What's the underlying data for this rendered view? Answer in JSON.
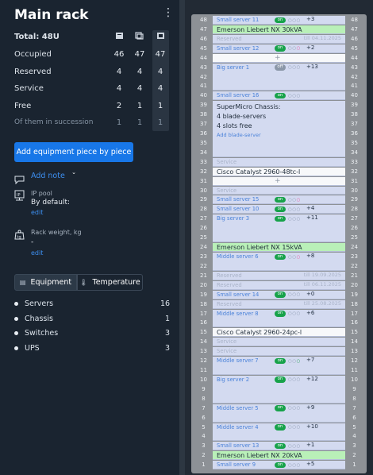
{
  "header": {
    "title": "Main rack",
    "chevron": "⌄",
    "menu": "⋮"
  },
  "summary": {
    "total_label": "Total: 48U",
    "rows": [
      {
        "label": "Occupied",
        "values": [
          "46",
          "47",
          "47"
        ]
      },
      {
        "label": "Reserved",
        "values": [
          "4",
          "4",
          "4"
        ]
      },
      {
        "label": "Service",
        "values": [
          "4",
          "4",
          "4"
        ]
      },
      {
        "label": "Free",
        "values": [
          "2",
          "1",
          "1"
        ]
      },
      {
        "label": "Of them in succession",
        "values": [
          "1",
          "1",
          "1"
        ]
      }
    ]
  },
  "add_button": {
    "label": "Add equipment piece by piece",
    "caret": "⌄"
  },
  "add_note": {
    "label": "Add note"
  },
  "ip_pool": {
    "label": "IP pool",
    "value": "By default:",
    "edit": "edit"
  },
  "rack_weight": {
    "label": "Rack weight, kg",
    "value": "-",
    "edit": "edit"
  },
  "tabs": [
    {
      "label": "Equipment",
      "active": true
    },
    {
      "label": "Temperature",
      "active": false
    }
  ],
  "legend": [
    {
      "label": "Servers",
      "count": "16"
    },
    {
      "label": "Chassis",
      "count": "1"
    },
    {
      "label": "Switches",
      "count": "3"
    },
    {
      "label": "UPS",
      "count": "3"
    }
  ],
  "rack": {
    "units": [
      {
        "u": 48,
        "kind": "srv",
        "text": "Small server 11",
        "status": "on",
        "plus": "+3"
      },
      {
        "u": 47,
        "kind": "ups",
        "text": "Emerson Liebert NX 30kVA"
      },
      {
        "u": 46,
        "kind": "res",
        "text": "Reserved",
        "date": "till 04.11.2025"
      },
      {
        "u": 45,
        "kind": "srv",
        "text": "Small server 12",
        "status": "on",
        "plus": "+2",
        "pink": true
      },
      {
        "u": 44,
        "kind": "free",
        "text": "+"
      },
      {
        "u": 43,
        "kind": "srv",
        "text": "Big server 1",
        "status": "off",
        "plus": "+13",
        "span": 3
      },
      {
        "u": 40,
        "kind": "srv",
        "text": "Small server 16",
        "status": "on",
        "plus": ""
      },
      {
        "u": 39,
        "kind": "chassis",
        "span": 6,
        "lines": [
          "SuperMicro Chassis:",
          "4 blade-servers",
          "4 slots free"
        ],
        "link": "Add blade-server"
      },
      {
        "u": 33,
        "kind": "svc",
        "text": "Service"
      },
      {
        "u": 32,
        "kind": "sw",
        "text": "Cisco Catalyst 2960-48tc-l"
      },
      {
        "u": 31,
        "kind": "free",
        "text": "+"
      },
      {
        "u": 30,
        "kind": "svc",
        "text": "Service"
      },
      {
        "u": 29,
        "kind": "srv",
        "text": "Small server 15",
        "status": "on",
        "plus": "",
        "pink": true
      },
      {
        "u": 28,
        "kind": "srv",
        "text": "Small server 10",
        "status": "on",
        "plus": "+4"
      },
      {
        "u": 27,
        "kind": "srv",
        "text": "Big server 3",
        "status": "on",
        "plus": "+11",
        "span": 3
      },
      {
        "u": 24,
        "kind": "ups",
        "text": "Emerson Liebert NX 15kVA"
      },
      {
        "u": 23,
        "kind": "srv",
        "text": "Middle server 6",
        "status": "on",
        "plus": "+8",
        "pink": true,
        "span": 2
      },
      {
        "u": 21,
        "kind": "res",
        "text": "Reserved",
        "date": "till 19.09.2025"
      },
      {
        "u": 20,
        "kind": "res",
        "text": "Reserved",
        "date": "till 06.11.2025"
      },
      {
        "u": 19,
        "kind": "srv",
        "text": "Small server 14",
        "status": "on",
        "plus": "+0"
      },
      {
        "u": 18,
        "kind": "res",
        "text": "Reserved",
        "date": "till 25.08.2025"
      },
      {
        "u": 17,
        "kind": "srv",
        "text": "Middle server 8",
        "status": "on",
        "plus": "+6",
        "span": 2
      },
      {
        "u": 15,
        "kind": "sw",
        "text": "Cisco Catalyst 2960-24pc-l"
      },
      {
        "u": 14,
        "kind": "svc",
        "text": "Service"
      },
      {
        "u": 13,
        "kind": "svc",
        "text": "Service"
      },
      {
        "u": 12,
        "kind": "srv",
        "text": "Middle server 7",
        "status": "on",
        "plus": "+7",
        "green": true,
        "span": 2
      },
      {
        "u": 10,
        "kind": "srv",
        "text": "Big server 2",
        "status": "on",
        "plus": "+12",
        "span": 3
      },
      {
        "u": 7,
        "kind": "srv",
        "text": "Middle server 5",
        "status": "on",
        "plus": "+9",
        "span": 2
      },
      {
        "u": 5,
        "kind": "srv",
        "text": "Middle server 4",
        "status": "on",
        "plus": "+10",
        "span": 2
      },
      {
        "u": 3,
        "kind": "srv",
        "text": "Small server 13",
        "status": "on",
        "plus": "+1"
      },
      {
        "u": 2,
        "kind": "ups",
        "text": "Emerson Liebert NX 20kVA"
      },
      {
        "u": 1,
        "kind": "srv",
        "text": "Small server 9",
        "status": "on",
        "plus": "+5"
      }
    ]
  }
}
